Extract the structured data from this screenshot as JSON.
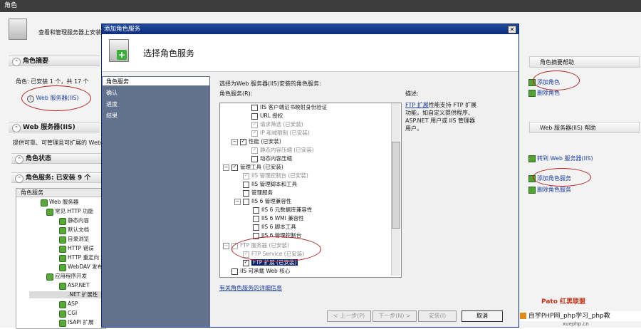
{
  "window": {
    "title": "角色"
  },
  "background": {
    "header_text": "查看和管理服务器上安装的角色",
    "roles_summary": {
      "title": "角色摘要",
      "roles_line": "角色: 已安装 1 个，共 17 个",
      "web_role": "Web 服务器(IIS)"
    },
    "web_server": {
      "title": "Web 服务器(IIS)",
      "desc": "提供可靠、可管理且可扩展的 Web 应用程序基础结构。",
      "role_status": "角色状态",
      "role_services": "角色服务: 已安装 9 个",
      "list_header": "角色服务",
      "items": [
        "Web 服务器",
        "常见 HTTP 功能",
        "静态内容",
        "默认文档",
        "目录浏览",
        "HTTP 错误",
        "HTTP 重定向",
        "WebDAV 发布",
        "应用程序开发",
        "ASP.NET",
        ".NET 扩展性",
        "ASP",
        "CGI",
        "ISAPI 扩展"
      ]
    },
    "right_panel": {
      "summary_help": "角色摘要帮助",
      "add_roles": "添加角色",
      "remove_roles": "删除角色",
      "web_help": "Web 服务器(IIS) 帮助",
      "goto_web": "转到 Web 服务器(IIS)",
      "add_role_services": "添加角色服务",
      "remove_role_services": "删除角色服务"
    }
  },
  "dialog": {
    "title": "添加角色服务",
    "close_glyph": "✕",
    "header": "选择角色服务",
    "nav": [
      "角色服务",
      "确认",
      "进度",
      "结果"
    ],
    "instruction": "选择为Web 服务器(IIS)安装的角色服务:",
    "tree_label": "角色服务(R):",
    "tree_items": [
      {
        "text": "IIS 客户端证书映射身份验证",
        "level": 3,
        "check": false,
        "gray": false
      },
      {
        "text": "URL 授权",
        "level": 3,
        "check": false,
        "gray": false
      },
      {
        "text": "请求筛选  (已安装)",
        "level": 3,
        "check": true,
        "gray": true
      },
      {
        "text": "IP 和域限制  (已安装)",
        "level": 3,
        "check": true,
        "gray": false
      },
      {
        "text": "性能  (已安装)",
        "level": 2,
        "check": true,
        "gray": false,
        "expander": "□"
      },
      {
        "text": "静态内容压缩  (已安装)",
        "level": 3,
        "check": true,
        "gray": true
      },
      {
        "text": "动态内容压缩",
        "level": 3,
        "check": false,
        "gray": false
      },
      {
        "text": "管理工具  (已安装)",
        "level": 1,
        "check": true,
        "gray": false,
        "expander": "□"
      },
      {
        "text": "IIS 管理控制台  (已安装)",
        "level": 2,
        "check": true,
        "gray": true
      },
      {
        "text": "IIS 管理脚本和工具",
        "level": 2,
        "check": false,
        "gray": false
      },
      {
        "text": "管理服务",
        "level": 2,
        "check": false,
        "gray": false
      },
      {
        "text": "IIS 6 管理兼容性",
        "level": 2,
        "check": false,
        "gray": false,
        "expander": "□"
      },
      {
        "text": "IIS 6 元数据库兼容性",
        "level": 3,
        "check": false,
        "gray": false
      },
      {
        "text": "IIS 6 WMI 兼容性",
        "level": 3,
        "check": false,
        "gray": false
      },
      {
        "text": "IIS 6 脚本工具",
        "level": 3,
        "check": false,
        "gray": false
      },
      {
        "text": "IIS 6 管理控制台",
        "level": 3,
        "check": false,
        "gray": false
      },
      {
        "text": "FTP 服务器  (已安装)",
        "level": 1,
        "check": true,
        "gray": true,
        "expander": "□"
      },
      {
        "text": "FTP Service  (已安装)",
        "level": 2,
        "check": true,
        "gray": true
      },
      {
        "text": "FTP 扩展  (已安装)",
        "level": 2,
        "check": true,
        "gray": false,
        "selected": true
      },
      {
        "text": "IIS 可承载 Web 核心",
        "level": 1,
        "check": false,
        "gray": false
      }
    ],
    "description_label": "描述:",
    "description_link": "FTP 扩展",
    "description_text": "性能支持 FTP 扩展功能，如自定义提供程序、ASP.NET 用户或 IIS 管理器用户。",
    "more_info": "有关角色服务的详细信息",
    "buttons": {
      "prev": "< 上一步(P)",
      "next": "下一步(N) >",
      "install": "安装(I)",
      "cancel": "取消"
    }
  },
  "watermark": {
    "text": "自学PHP网_php学习_php教",
    "logo": "Pato 红黑联盟",
    "domain": "xuephp.cn"
  }
}
